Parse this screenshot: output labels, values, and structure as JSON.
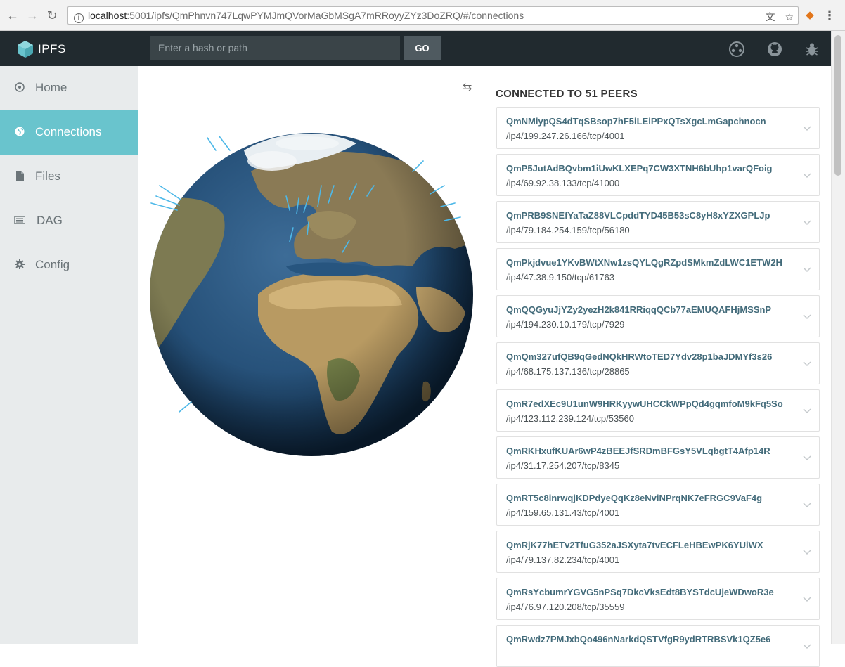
{
  "browser": {
    "url_host": "localhost",
    "url_path": ":5001/ipfs/QmPhnvn747LqwPYMJmQVorMaGbMSgA7mRRoyyZYz3DoZRQ/#/connections"
  },
  "header": {
    "logo_text": "IPFS",
    "search_placeholder": "Enter a hash or path",
    "go_label": "GO"
  },
  "sidebar": {
    "items": [
      {
        "label": "Home",
        "icon": "home-icon"
      },
      {
        "label": "Connections",
        "icon": "globe-icon",
        "active": true
      },
      {
        "label": "Files",
        "icon": "file-icon"
      },
      {
        "label": "DAG",
        "icon": "dag-icon"
      },
      {
        "label": "Config",
        "icon": "gear-icon"
      }
    ]
  },
  "main": {
    "peers_title": "CONNECTED TO 51 PEERS",
    "peers": [
      {
        "id": "QmNMiypQS4dTqSBsop7hF5iLEiPPxQTsXgcLmGapchnocn",
        "addr": "/ip4/199.247.26.166/tcp/4001"
      },
      {
        "id": "QmP5JutAdBQvbm1iUwKLXEPq7CW3XTNH6bUhp1varQFoig",
        "addr": "/ip4/69.92.38.133/tcp/41000"
      },
      {
        "id": "QmPRB9SNEfYaTaZ88VLCpddTYD45B53sC8yH8xYZXGPLJp",
        "addr": "/ip4/79.184.254.159/tcp/56180"
      },
      {
        "id": "QmPkjdvue1YKvBWtXNw1zsQYLQgRZpdSMkmZdLWC1ETW2H",
        "addr": "/ip4/47.38.9.150/tcp/61763"
      },
      {
        "id": "QmQQGyuJjYZy2yezH2k841RRiqqQCb77aEMUQAFHjMSSnP",
        "addr": "/ip4/194.230.10.179/tcp/7929"
      },
      {
        "id": "QmQm327ufQB9qGedNQkHRWtoTED7Ydv28p1baJDMYf3s26",
        "addr": "/ip4/68.175.137.136/tcp/28865"
      },
      {
        "id": "QmR7edXEc9U1unW9HRKyywUHCCkWPpQd4gqmfoM9kFq5So",
        "addr": "/ip4/123.112.239.124/tcp/53560"
      },
      {
        "id": "QmRKHxufKUAr6wP4zBEEJfSRDmBFGsY5VLqbgtT4Afp14R",
        "addr": "/ip4/31.17.254.207/tcp/8345"
      },
      {
        "id": "QmRT5c8inrwqjKDPdyeQqKz8eNviNPrqNK7eFRGC9VaF4g",
        "addr": "/ip4/159.65.131.43/tcp/4001"
      },
      {
        "id": "QmRjK77hETv2TfuG352aJSXyta7tvECFLeHBEwPK6YUiWX",
        "addr": "/ip4/79.137.82.234/tcp/4001"
      },
      {
        "id": "QmRsYcbumrYGVG5nPSq7DkcVksEdt8BYSTdcUjeWDwoR3e",
        "addr": "/ip4/76.97.120.208/tcp/35559"
      },
      {
        "id": "QmRwdz7PMJxbQo496nNarkdQSTVfgR9ydRTRBSVk1QZ5e6",
        "addr": ""
      }
    ]
  },
  "colors": {
    "topbar": "#212a2f",
    "sidebar": "#e8ebec",
    "active": "#69c4cd",
    "peer_id": "#436b7a"
  }
}
